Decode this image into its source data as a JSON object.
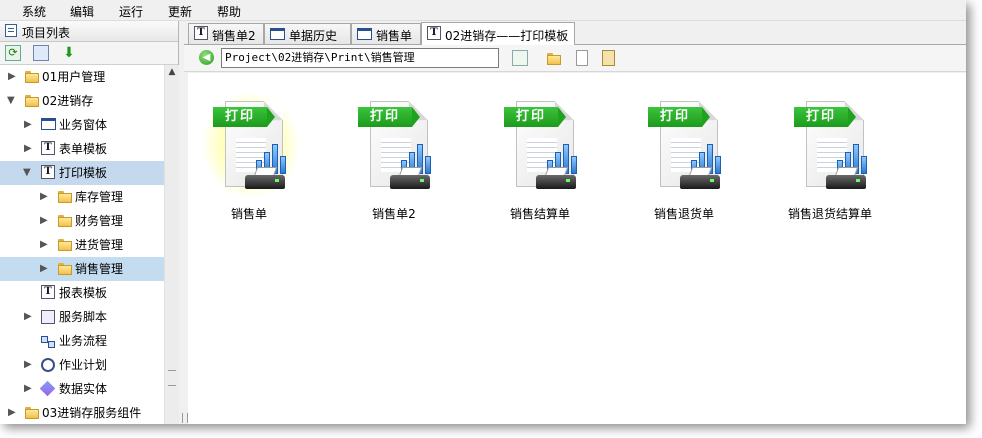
{
  "menu": [
    "系统",
    "编辑",
    "运行",
    "更新",
    "帮助"
  ],
  "project_panel": {
    "title": "项目列表",
    "tools": [
      "refresh-icon",
      "properties-icon",
      "download-icon"
    ]
  },
  "tree": [
    {
      "label": "01用户管理",
      "expanded": false,
      "icon": "folder-icon"
    },
    {
      "label": "02进销存",
      "expanded": true,
      "icon": "folder-open-icon"
    },
    {
      "label": "业务窗体",
      "expanded": false,
      "icon": "window-icon"
    },
    {
      "label": "表单模板",
      "expanded": false,
      "icon": "form-template-icon"
    },
    {
      "label": "打印模板",
      "expanded": true,
      "icon": "print-template-icon",
      "selected": true
    },
    {
      "label": "库存管理",
      "expanded": false,
      "icon": "folder-icon"
    },
    {
      "label": "财务管理",
      "expanded": false,
      "icon": "folder-icon"
    },
    {
      "label": "进货管理",
      "expanded": false,
      "icon": "folder-icon"
    },
    {
      "label": "销售管理",
      "expanded": false,
      "icon": "folder-icon",
      "selected": true
    },
    {
      "label": "报表模板",
      "icon": "report-template-icon"
    },
    {
      "label": "服务脚本",
      "expanded": false,
      "icon": "script-icon"
    },
    {
      "label": "业务流程",
      "icon": "workflow-icon"
    },
    {
      "label": "作业计划",
      "expanded": false,
      "icon": "schedule-icon"
    },
    {
      "label": "数据实体",
      "expanded": false,
      "icon": "data-entity-icon"
    },
    {
      "label": "03进销存服务组件",
      "expanded": false,
      "icon": "folder-icon"
    }
  ],
  "tabs": [
    {
      "label": "销售单2",
      "icon": "text-template-icon"
    },
    {
      "label": "单据历史",
      "icon": "window-icon"
    },
    {
      "label": "销售单",
      "icon": "window-icon"
    },
    {
      "label": "02进销存——打印模板",
      "icon": "text-template-icon",
      "active": true
    }
  ],
  "address": {
    "path": "Project\\02进销存\\Print\\销售管理"
  },
  "address_buttons": [
    "refresh-path-icon",
    "new-folder-icon",
    "new-file-icon",
    "paste-icon"
  ],
  "files": [
    {
      "badge": "打印",
      "label": "销售单",
      "highlighted": true
    },
    {
      "badge": "打印",
      "label": "销售单2"
    },
    {
      "badge": "打印",
      "label": "销售结算单"
    },
    {
      "badge": "打印",
      "label": "销售退货单"
    },
    {
      "badge": "打印",
      "label": "销售退货结算单"
    }
  ]
}
